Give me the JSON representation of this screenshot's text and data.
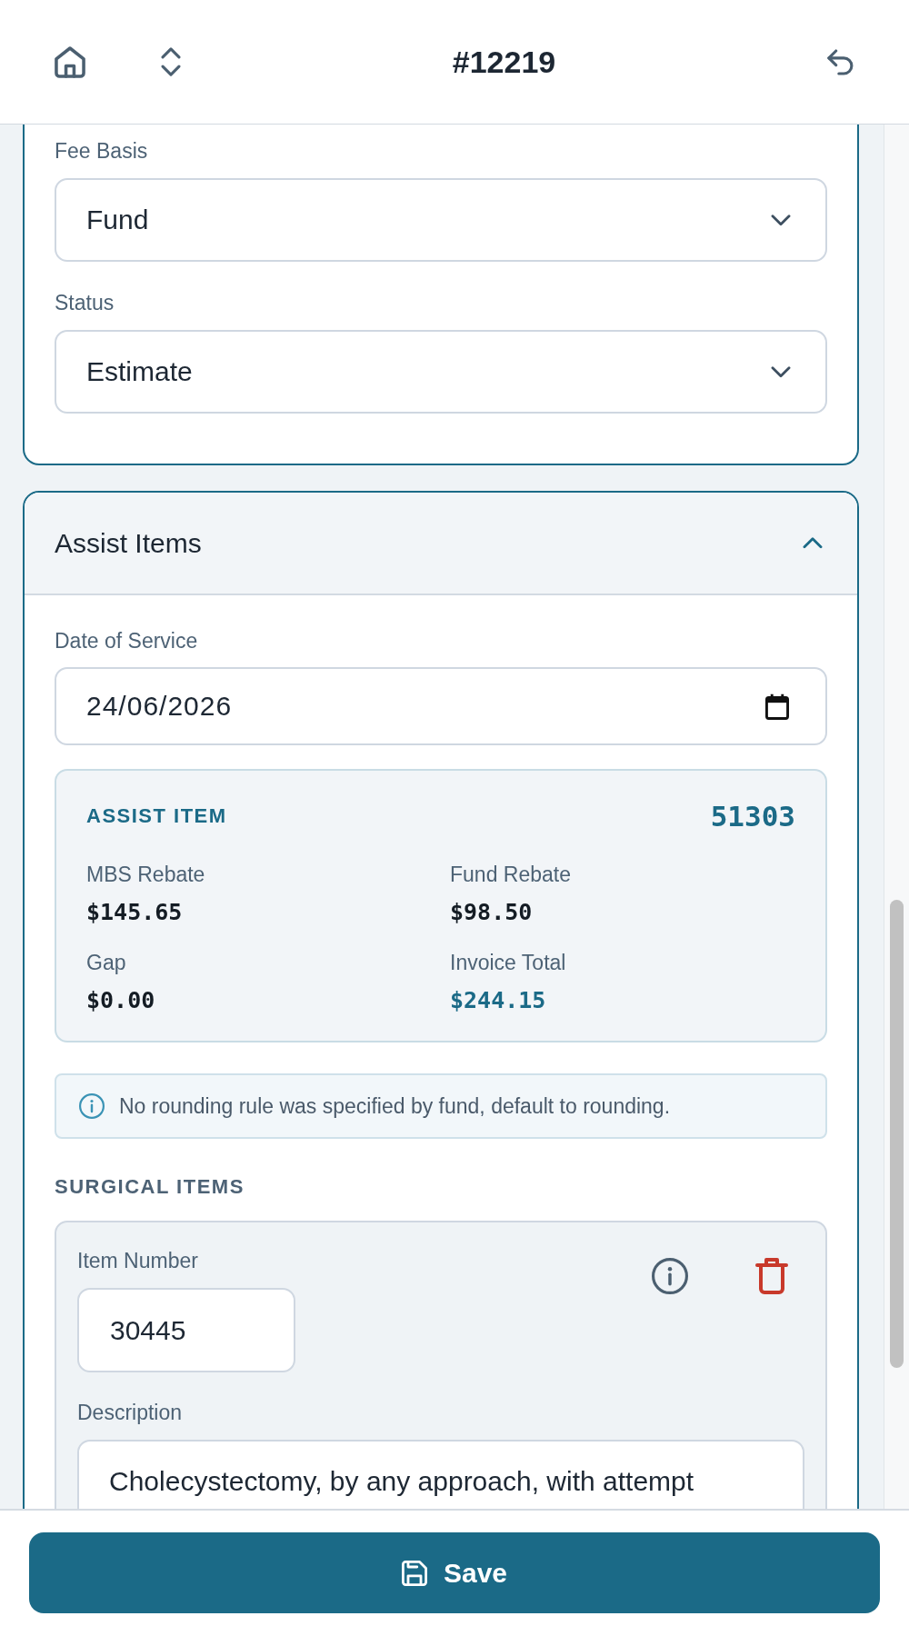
{
  "header": {
    "title": "#12219"
  },
  "details_card": {
    "fields": [
      {
        "kind": "select",
        "label": "Fee Basis",
        "value": "Fund"
      },
      {
        "kind": "select",
        "label": "Status",
        "value": "Estimate"
      }
    ]
  },
  "assist_items_section": {
    "title": "Assist Items",
    "expanded": true,
    "fields": [
      {
        "kind": "date",
        "label": "Date of Service",
        "value": "24/06/2026"
      }
    ],
    "assist_item": {
      "heading": "ASSIST ITEM",
      "item_number": "51303",
      "amounts": [
        {
          "kind": "amount",
          "label": "MBS Rebate",
          "value": "$145.65"
        },
        {
          "kind": "amount",
          "label": "Fund Rebate",
          "value": "$98.50"
        },
        {
          "kind": "amount",
          "label": "Gap",
          "value": "$0.00"
        },
        {
          "kind": "total",
          "label": "Invoice Total",
          "value": "$244.15"
        }
      ]
    },
    "note": "No rounding rule was specified by fund, default to rounding.",
    "surgical_items": {
      "heading": "SURGICAL ITEMS",
      "items": [
        {
          "item_number": {
            "label": "Item Number",
            "value": "30445"
          },
          "description": {
            "label": "Description",
            "value": "Cholecystectomy, by any approach, with attempt"
          }
        }
      ]
    }
  },
  "footer": {
    "save_button": "Save"
  }
}
